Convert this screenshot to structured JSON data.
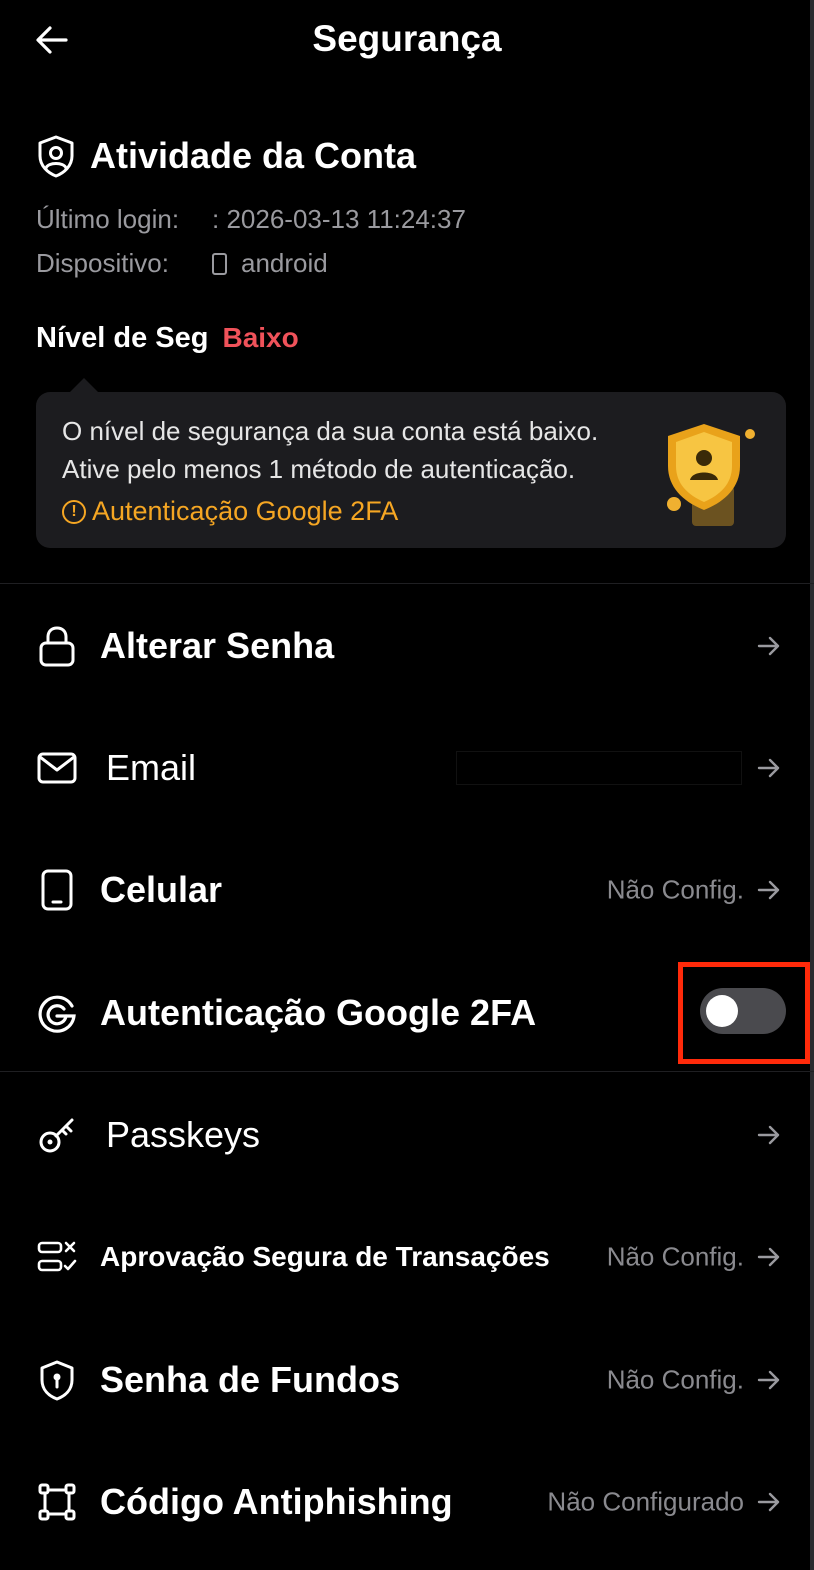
{
  "header": {
    "title": "Segurança"
  },
  "account": {
    "title": "Atividade da Conta",
    "last_login_label": "Último login:",
    "last_login_value": ": 2026-03-13 11:24:37",
    "device_label": "Dispositivo:",
    "device_value": "android"
  },
  "security_level": {
    "label": "Nível de Seg",
    "value": "Baixo",
    "value_color": "#f0525a"
  },
  "notice": {
    "line1": "O nível de segurança da sua conta está baixo.",
    "line2": "Ative pelo menos 1 método de autenticação.",
    "link": "Autenticação Google 2FA",
    "link_color": "#f5a623"
  },
  "settings": [
    {
      "label": "Alterar Senha",
      "status": "",
      "icon": "lock-icon"
    },
    {
      "label": "Email",
      "status": "",
      "icon": "mail-icon"
    },
    {
      "label": "Celular",
      "status": "Não Config.",
      "icon": "phone-icon"
    },
    {
      "label": "Autenticação Google 2FA",
      "status": "",
      "icon": "google-icon",
      "toggle_on": false
    },
    {
      "label": "Passkeys",
      "status": "",
      "icon": "key-icon"
    },
    {
      "label": "Aprovação Segura de Transações",
      "status": "Não Config.",
      "icon": "transaction-approval-icon"
    },
    {
      "label": "Senha de Fundos",
      "status": "Não Config.",
      "icon": "shield-lock-icon"
    },
    {
      "label": "Código Antiphishing",
      "status": "Não Configurado",
      "icon": "frame-icon"
    }
  ]
}
